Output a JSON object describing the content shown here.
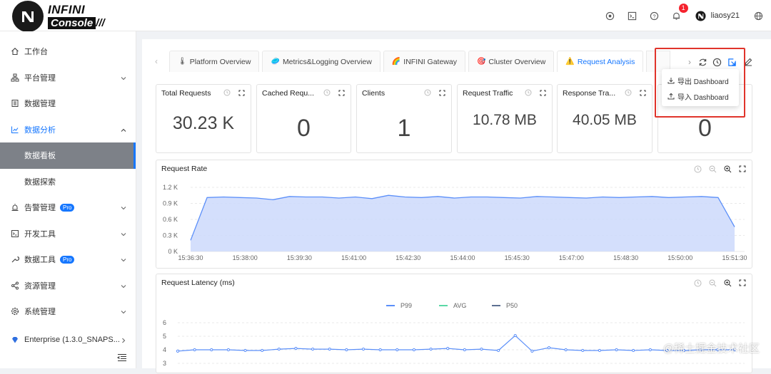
{
  "header": {
    "logo_line1": "INFINI",
    "logo_line2": "Console",
    "logo_bars": "///",
    "notification_count": "1",
    "username": "liaosy21"
  },
  "sidebar": {
    "items": [
      {
        "label": "工作台",
        "icon": "home-icon"
      },
      {
        "label": "平台管理",
        "icon": "cluster-icon"
      },
      {
        "label": "数据管理",
        "icon": "database-icon"
      },
      {
        "label": "数据分析",
        "icon": "chart-icon"
      },
      {
        "label": "数据看板",
        "icon": ""
      },
      {
        "label": "数据探索",
        "icon": ""
      },
      {
        "label": "告警管理",
        "icon": "alert-icon",
        "badge": "Pro"
      },
      {
        "label": "开发工具",
        "icon": "terminal-icon"
      },
      {
        "label": "数据工具",
        "icon": "tool-icon",
        "badge": "Pro"
      },
      {
        "label": "资源管理",
        "icon": "share-icon"
      },
      {
        "label": "系统管理",
        "icon": "settings-icon"
      },
      {
        "label": "Enterprise (1.3.0_SNAPS...",
        "icon": "diamond-icon"
      }
    ]
  },
  "tabs": [
    {
      "label": "Platform Overview",
      "emoji": "🌡"
    },
    {
      "label": "Metrics&Logging Overview",
      "emoji": "🥏"
    },
    {
      "label": "INFINI Gateway",
      "emoji": "🌈"
    },
    {
      "label": "Cluster Overview",
      "emoji": "🎯"
    },
    {
      "label": "Request Analysis",
      "emoji": "⚠️"
    }
  ],
  "dropdown": {
    "export_label": "导出 Dashboard",
    "import_label": "导入 Dashboard"
  },
  "stat_cards": [
    {
      "title": "Total Requests",
      "value": "30.23 K"
    },
    {
      "title": "Cached Requ...",
      "value": "0"
    },
    {
      "title": "Clients",
      "value": "1"
    },
    {
      "title": "Request Traffic",
      "value": "10.78 MB"
    },
    {
      "title": "Response Tra...",
      "value": "40.05 MB"
    },
    {
      "title": "",
      "value": "0"
    }
  ],
  "panels": {
    "request_rate": {
      "title": "Request Rate"
    },
    "request_latency": {
      "title": "Request Latency (ms)"
    }
  },
  "watermark": "@稀土掘金技术社区",
  "colors": {
    "accent": "#1677ff",
    "area_fill": "#ccd9fb",
    "line": "#5b8ff9",
    "highlight_border": "#e0342b"
  },
  "chart_data": [
    {
      "type": "area",
      "title": "Request Rate",
      "x": [
        "15:36:30",
        "15:38:00",
        "15:39:30",
        "15:41:00",
        "15:42:30",
        "15:44:00",
        "15:45:30",
        "15:47:00",
        "15:48:30",
        "15:50:00",
        "15:51:30"
      ],
      "y_ticks": [
        "0 K",
        "0.3 K",
        "0.6 K",
        "0.9 K",
        "1.2 K"
      ],
      "ylim": [
        0,
        1.2
      ],
      "series": [
        {
          "values": [
            0.21,
            1.01,
            1.02,
            1.01,
            1.0,
            0.97,
            1.03,
            1.02,
            1.02,
            1.0,
            1.02,
            0.99,
            1.05,
            1.02,
            1.01,
            1.03,
            1.0,
            1.02,
            1.02,
            1.01,
            1.0,
            1.03,
            1.02,
            1.01,
            1.0,
            1.02,
            1.01,
            1.02,
            1.03,
            1.01,
            1.02,
            1.03,
            1.01,
            0.46
          ]
        }
      ]
    },
    {
      "type": "line",
      "title": "Request Latency (ms)",
      "y_ticks": [
        "3",
        "4",
        "5",
        "6"
      ],
      "ylim": [
        3,
        6
      ],
      "legend": "top",
      "series": [
        {
          "name": "P99",
          "color": "#5b8ff9",
          "values": [
            3.9,
            4.0,
            4.0,
            4.0,
            3.95,
            3.95,
            4.05,
            4.1,
            4.05,
            4.05,
            4.0,
            4.05,
            4.0,
            4.0,
            4.0,
            4.05,
            4.1,
            4.0,
            4.05,
            3.95,
            5.05,
            3.9,
            4.15,
            4.0,
            3.95,
            3.95,
            4.0,
            3.95,
            4.0,
            3.95,
            3.95,
            4.0,
            4.0,
            4.0
          ]
        },
        {
          "name": "AVG",
          "color": "#5ad8a6",
          "values": []
        },
        {
          "name": "P50",
          "color": "#5d7092",
          "values": []
        }
      ]
    }
  ]
}
